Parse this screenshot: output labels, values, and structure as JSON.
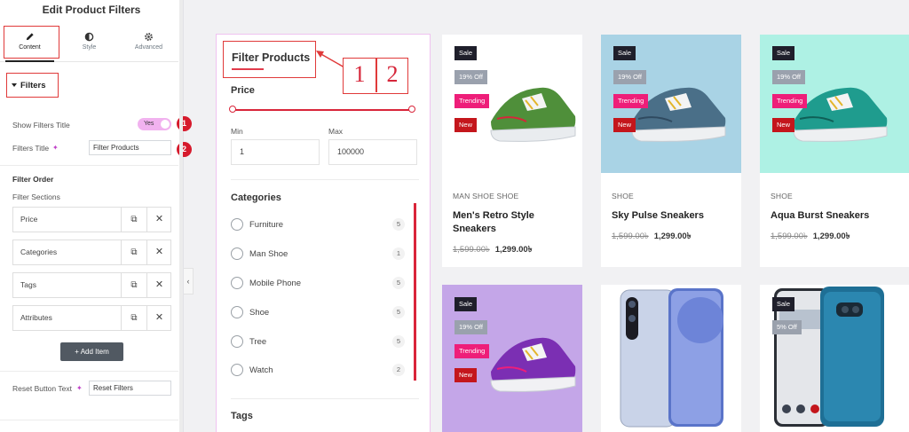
{
  "panel": {
    "title": "Edit Product Filters",
    "tabs": [
      {
        "label": "Content",
        "icon": "pencil-icon"
      },
      {
        "label": "Style",
        "icon": "half-circle-icon"
      },
      {
        "label": "Advanced",
        "icon": "gear-icon"
      }
    ],
    "section_label": "Filters",
    "show_title_label": "Show Filters Title",
    "show_title_toggle": "Yes",
    "filters_title_label": "Filters Title",
    "filters_title_value": "Filter Products",
    "filter_order_label": "Filter Order",
    "filter_sections_label": "Filter Sections",
    "repeater_items": [
      "Price",
      "Categories",
      "Tags",
      "Attributes"
    ],
    "add_item_label": "Add Item",
    "reset_label": "Reset Button Text",
    "reset_value": "Reset Filters",
    "annotations": [
      "1",
      "2"
    ]
  },
  "filter": {
    "title": "Filter Products",
    "price_heading": "Price",
    "min_label": "Min",
    "max_label": "Max",
    "min_value": "1",
    "max_value": "100000",
    "categories_heading": "Categories",
    "categories": [
      {
        "label": "Furniture",
        "count": "5"
      },
      {
        "label": "Man Shoe",
        "count": "1"
      },
      {
        "label": "Mobile Phone",
        "count": "5"
      },
      {
        "label": "Shoe",
        "count": "5"
      },
      {
        "label": "Tree",
        "count": "5"
      },
      {
        "label": "Watch",
        "count": "2"
      }
    ],
    "tags_heading": "Tags",
    "callout": [
      "1",
      "2"
    ]
  },
  "products": [
    {
      "tags": [
        "Sale",
        "19% Off",
        "Trending",
        "New"
      ],
      "category": "MAN SHOE   SHOE",
      "name": "Men's Retro Style Sneakers",
      "old_price": "1,599.00৳",
      "new_price": "1,299.00৳",
      "bg": "#ffffff"
    },
    {
      "tags": [
        "Sale",
        "19% Off",
        "Trending",
        "New"
      ],
      "category": "SHOE",
      "name": "Sky Pulse Sneakers",
      "old_price": "1,599.00৳",
      "new_price": "1,299.00৳",
      "bg": "#a9d3e5"
    },
    {
      "tags": [
        "Sale",
        "19% Off",
        "Trending",
        "New"
      ],
      "category": "SHOE",
      "name": "Aqua Burst Sneakers",
      "old_price": "1,599.00৳",
      "new_price": "1,299.00৳",
      "bg": "#aef1e4"
    },
    {
      "tags": [
        "Sale",
        "19% Off",
        "Trending",
        "New"
      ],
      "bg": "#c4a6e8"
    },
    {
      "tags": [],
      "bg": "#ffffff"
    },
    {
      "tags": [
        "Sale",
        "5% Off"
      ],
      "bg": "#ffffff"
    }
  ],
  "colors": {
    "accent": "#d9253a",
    "annotation": "#e03a3a",
    "panel_dark": "#515962"
  }
}
